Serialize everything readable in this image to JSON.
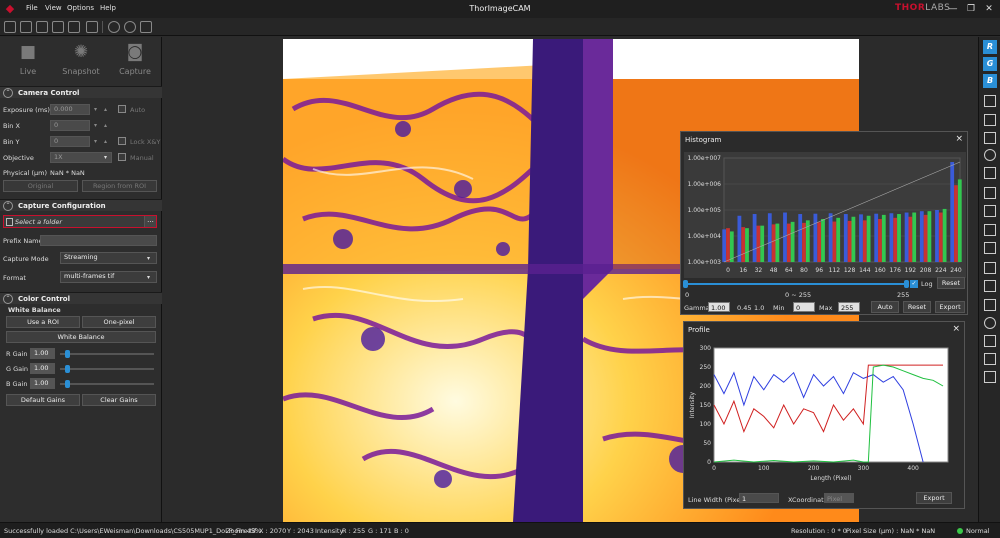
{
  "app": {
    "title": "ThorImageCAM",
    "brand_main": "THOR",
    "brand_sub": "LABS",
    "accent": "#c8102e",
    "highlight": "#2a8fd6"
  },
  "menu": [
    "File",
    "View",
    "Options",
    "Help"
  ],
  "modes": [
    {
      "label": "Live",
      "icon": "video-camera-icon"
    },
    {
      "label": "Snapshot",
      "icon": "aperture-icon"
    },
    {
      "label": "Capture",
      "icon": "camera-icon"
    }
  ],
  "camera_control": {
    "title": "Camera Control",
    "exposure_label": "Exposure (ms)",
    "exposure_value": "0.000",
    "auto_label": "Auto",
    "binx_label": "Bin X",
    "binx_value": "0",
    "biny_label": "Bin Y",
    "biny_value": "0",
    "lock_label": "Lock X&Y",
    "objective_label": "Objective",
    "objective_value": "1X",
    "manual_label": "Manual",
    "physical_label": "Physical (μm)",
    "physical_value": "NaN * NaN",
    "original_button": "Original",
    "roi_button": "Region from ROI"
  },
  "capture_config": {
    "title": "Capture Configuration",
    "folder_placeholder": "Select a folder",
    "folder_dots": "...",
    "prefix_label": "Prefix Name",
    "prefix_value": "",
    "mode_label": "Capture Mode",
    "mode_value": "Streaming",
    "format_label": "Format",
    "format_value": "multi-frames tif"
  },
  "color_control": {
    "title": "Color Control",
    "wb_label": "White Balance",
    "use_roi": "Use a ROI",
    "one_pixel": "One-pixel",
    "white_balance_button": "White Balance",
    "gains": [
      {
        "label": "R Gain",
        "value": "1.00",
        "fraction": 0.05
      },
      {
        "label": "G Gain",
        "value": "1.00",
        "fraction": 0.05
      },
      {
        "label": "B Gain",
        "value": "1.00",
        "fraction": 0.05
      }
    ],
    "default_gains": "Default Gains",
    "clear_gains": "Clear Gains"
  },
  "right_channels": [
    "R",
    "G",
    "B"
  ],
  "histogram": {
    "title": "Histogram",
    "close": "×",
    "range_left": "0",
    "range_mid": "0 ~ 255",
    "range_right": "255",
    "log_label": "Log",
    "reset_top": "Reset",
    "gamma_label": "Gamma",
    "gamma_value": "1.00",
    "gamma_min": "0.45",
    "gamma_max": "1.0",
    "min_label": "Min",
    "min_value": "0",
    "max_label": "Max",
    "max_value": "255",
    "auto": "Auto",
    "reset": "Reset",
    "export": "Export",
    "chart_data": {
      "type": "bar",
      "yscale": "log",
      "y_ticks": [
        "1.00e+007",
        "1.00e+006",
        "1.00e+005",
        "1.00e+004",
        "1.00e+003"
      ],
      "x_ticks": [
        "0",
        "16",
        "32",
        "48",
        "64",
        "80",
        "96",
        "112",
        "128",
        "144",
        "160",
        "176",
        "192",
        "208",
        "224",
        "240"
      ],
      "xlim": [
        0,
        255
      ],
      "ylim": [
        1000,
        10000000
      ],
      "series": [
        {
          "color": "#3a5bd9",
          "values": [
            18000,
            60000,
            70000,
            75000,
            80000,
            70000,
            72000,
            75000,
            70000,
            68000,
            72000,
            75000,
            80000,
            90000,
            100000,
            7000000
          ]
        },
        {
          "color": "#c83232",
          "values": [
            20000,
            22000,
            25000,
            28000,
            30000,
            32000,
            34000,
            36000,
            38000,
            40000,
            45000,
            50000,
            55000,
            65000,
            80000,
            900000
          ]
        },
        {
          "color": "#32c850",
          "values": [
            15000,
            20000,
            25000,
            30000,
            35000,
            40000,
            45000,
            50000,
            55000,
            60000,
            65000,
            70000,
            80000,
            90000,
            110000,
            1500000
          ]
        }
      ]
    }
  },
  "profile": {
    "title": "Profile",
    "close": "×",
    "line_width_label": "Line Width (Pixel)",
    "line_width_value": "1",
    "xcoord_label": "XCoordinate",
    "xcoord_value": "Pixel",
    "export": "Export",
    "chart_data": {
      "type": "line",
      "xlabel": "Length (Pixel)",
      "ylabel": "Intensity",
      "xlim": [
        0,
        470
      ],
      "ylim": [
        0,
        300
      ],
      "x_ticks": [
        "0",
        "100",
        "200",
        "300",
        "400"
      ],
      "y_ticks": [
        "0",
        "50",
        "100",
        "150",
        "200",
        "250",
        "300"
      ],
      "series": [
        {
          "color": "#2f3fe0",
          "x": [
            0,
            20,
            40,
            60,
            80,
            100,
            120,
            140,
            160,
            180,
            200,
            220,
            240,
            260,
            280,
            300,
            320,
            340,
            360,
            380,
            400,
            420
          ],
          "y": [
            230,
            180,
            235,
            150,
            225,
            190,
            230,
            210,
            235,
            170,
            230,
            200,
            225,
            180,
            235,
            220,
            230,
            210,
            225,
            190,
            100,
            0
          ]
        },
        {
          "color": "#d02020",
          "x": [
            0,
            20,
            40,
            60,
            80,
            100,
            120,
            140,
            160,
            180,
            200,
            220,
            240,
            260,
            280,
            300,
            310,
            320,
            360,
            420,
            460
          ],
          "y": [
            150,
            100,
            160,
            80,
            140,
            120,
            90,
            150,
            100,
            140,
            130,
            80,
            150,
            110,
            140,
            100,
            255,
            255,
            255,
            255,
            255
          ]
        },
        {
          "color": "#20c040",
          "x": [
            0,
            40,
            80,
            120,
            160,
            200,
            240,
            280,
            300,
            310,
            320,
            340,
            360,
            380,
            400,
            420,
            440,
            460
          ],
          "y": [
            0,
            5,
            0,
            4,
            0,
            3,
            0,
            5,
            0,
            0,
            250,
            255,
            250,
            240,
            230,
            220,
            215,
            200
          ]
        }
      ]
    }
  },
  "status": {
    "message": "Successfully loaded C:\\Users\\EWeisman\\Downloads\\CS505MUP1_DoLP_Fire.tif.",
    "zoom": "Zoom 45%",
    "x": "X : 2070",
    "y": "Y : 2043",
    "intensity": "Intensity",
    "r": "R : 255",
    "g": "G : 171",
    "b": "B : 0",
    "resolution": "Resolution : 0 * 0",
    "pixel_size": "Pixel Size (μm) : NaN * NaN",
    "mode": "Normal",
    "ok_color": "#3cc84a"
  }
}
